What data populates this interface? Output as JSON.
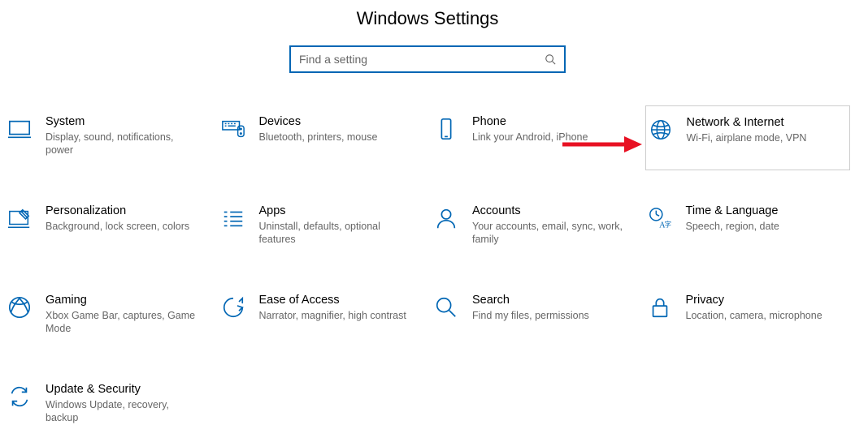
{
  "title": "Windows Settings",
  "search": {
    "placeholder": "Find a setting"
  },
  "tiles": {
    "system": {
      "label": "System",
      "desc": "Display, sound, notifications, power"
    },
    "devices": {
      "label": "Devices",
      "desc": "Bluetooth, printers, mouse"
    },
    "phone": {
      "label": "Phone",
      "desc": "Link your Android, iPhone"
    },
    "network": {
      "label": "Network & Internet",
      "desc": "Wi-Fi, airplane mode, VPN"
    },
    "personal": {
      "label": "Personalization",
      "desc": "Background, lock screen, colors"
    },
    "apps": {
      "label": "Apps",
      "desc": "Uninstall, defaults, optional features"
    },
    "accounts": {
      "label": "Accounts",
      "desc": "Your accounts, email, sync, work, family"
    },
    "time": {
      "label": "Time & Language",
      "desc": "Speech, region, date"
    },
    "gaming": {
      "label": "Gaming",
      "desc": "Xbox Game Bar, captures, Game Mode"
    },
    "ease": {
      "label": "Ease of Access",
      "desc": "Narrator, magnifier, high contrast"
    },
    "searchc": {
      "label": "Search",
      "desc": "Find my files, permissions"
    },
    "privacy": {
      "label": "Privacy",
      "desc": "Location, camera, microphone"
    },
    "update": {
      "label": "Update & Security",
      "desc": "Windows Update, recovery, backup"
    }
  }
}
